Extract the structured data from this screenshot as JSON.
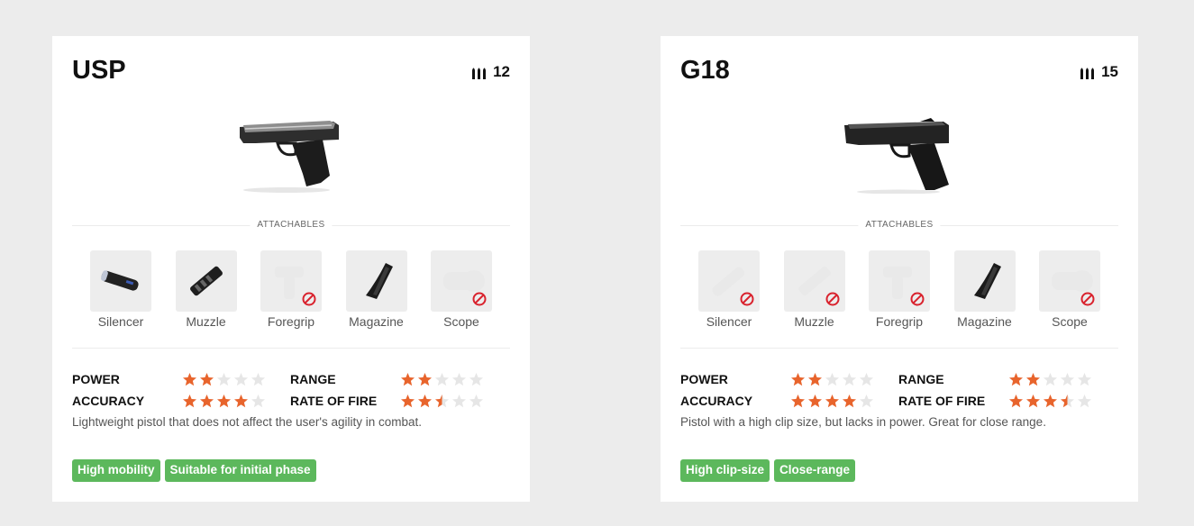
{
  "colors": {
    "star_on": "#e8642c",
    "star_off": "#e6e6e6",
    "tag_bg": "#5cb85c",
    "ban": "#d9232e"
  },
  "attachables_label": "ATTACHABLES",
  "cards": [
    {
      "name": "USP",
      "ammo": "12",
      "icon": "pistol-usp-image",
      "attachments": [
        {
          "label": "Silencer",
          "icon": "silencer-icon",
          "available": true
        },
        {
          "label": "Muzzle",
          "icon": "muzzle-icon",
          "available": true
        },
        {
          "label": "Foregrip",
          "icon": "foregrip-icon",
          "available": false
        },
        {
          "label": "Magazine",
          "icon": "magazine-icon",
          "available": true
        },
        {
          "label": "Scope",
          "icon": "scope-icon",
          "available": false
        }
      ],
      "stats": [
        {
          "label": "POWER",
          "rating": 2
        },
        {
          "label": "RANGE",
          "rating": 2
        },
        {
          "label": "ACCURACY",
          "rating": 4
        },
        {
          "label": "RATE OF FIRE",
          "rating": 2.5
        }
      ],
      "description": "Lightweight pistol that does not affect the user's agility in combat.",
      "tags": [
        "High mobility",
        "Suitable for initial phase"
      ]
    },
    {
      "name": "G18",
      "ammo": "15",
      "icon": "pistol-g18-image",
      "attachments": [
        {
          "label": "Silencer",
          "icon": "silencer-icon",
          "available": false
        },
        {
          "label": "Muzzle",
          "icon": "muzzle-icon",
          "available": false
        },
        {
          "label": "Foregrip",
          "icon": "foregrip-icon",
          "available": false
        },
        {
          "label": "Magazine",
          "icon": "magazine-icon",
          "available": true
        },
        {
          "label": "Scope",
          "icon": "scope-icon",
          "available": false
        }
      ],
      "stats": [
        {
          "label": "POWER",
          "rating": 2
        },
        {
          "label": "RANGE",
          "rating": 2
        },
        {
          "label": "ACCURACY",
          "rating": 4
        },
        {
          "label": "RATE OF FIRE",
          "rating": 3.5
        }
      ],
      "description": "Pistol with a high clip size, but lacks in power. Great for close range.",
      "tags": [
        "High clip-size",
        "Close-range"
      ]
    }
  ]
}
